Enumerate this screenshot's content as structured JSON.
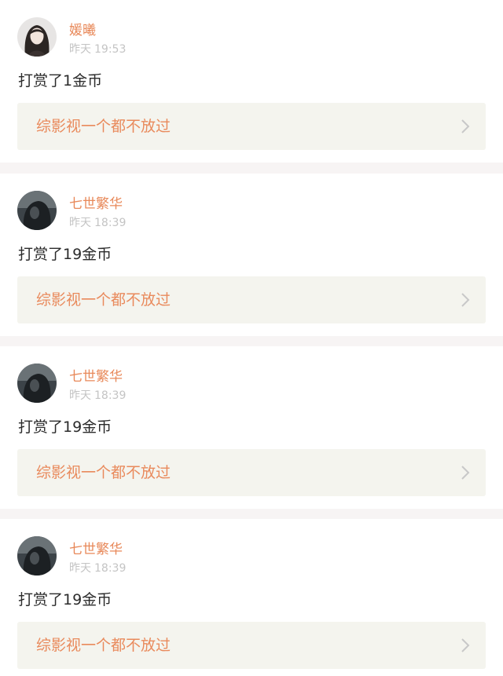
{
  "rewards": [
    {
      "user": "媛曦",
      "day": "昨天",
      "time": "19:53",
      "action": "打赏了1金币",
      "book": "综影视一个都不放过",
      "avatar": "avatar-girl-portrait"
    },
    {
      "user": "七世繁华",
      "day": "昨天",
      "time": "18:39",
      "action": "打赏了19金币",
      "book": "综影视一个都不放过",
      "avatar": "avatar-dark-figure"
    },
    {
      "user": "七世繁华",
      "day": "昨天",
      "time": "18:39",
      "action": "打赏了19金币",
      "book": "综影视一个都不放过",
      "avatar": "avatar-dark-figure"
    },
    {
      "user": "七世繁华",
      "day": "昨天",
      "time": "18:39",
      "action": "打赏了19金币",
      "book": "综影视一个都不放过",
      "avatar": "avatar-dark-figure"
    }
  ],
  "colors": {
    "accent": "#e8895a",
    "meta": "#c4c4c4",
    "text": "#2b2b2b",
    "card_bg": "#ffffff",
    "book_bg": "#f4f4ee",
    "divider": "#f7f4f4"
  }
}
